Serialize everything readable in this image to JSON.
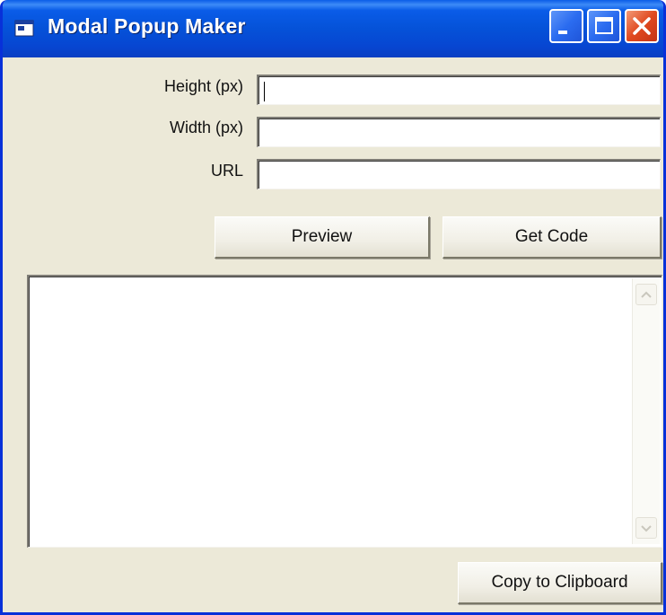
{
  "window": {
    "title": "Modal Popup Maker",
    "app_icon": "window-app-icon",
    "controls": {
      "minimize_icon": "minimize-icon",
      "maximize_icon": "maximize-icon",
      "close_icon": "close-icon"
    }
  },
  "form": {
    "height_label": "Height (px)",
    "height_value": "",
    "width_label": "Width (px)",
    "width_value": "",
    "url_label": "URL",
    "url_value": ""
  },
  "actions": {
    "preview_label": "Preview",
    "get_code_label": "Get Code"
  },
  "output": {
    "code_text": ""
  },
  "footer": {
    "copy_label": "Copy to Clipboard"
  },
  "colors": {
    "titlebar": "#0552d8",
    "window_face": "#ece9d8",
    "close_button": "#e0491f"
  }
}
